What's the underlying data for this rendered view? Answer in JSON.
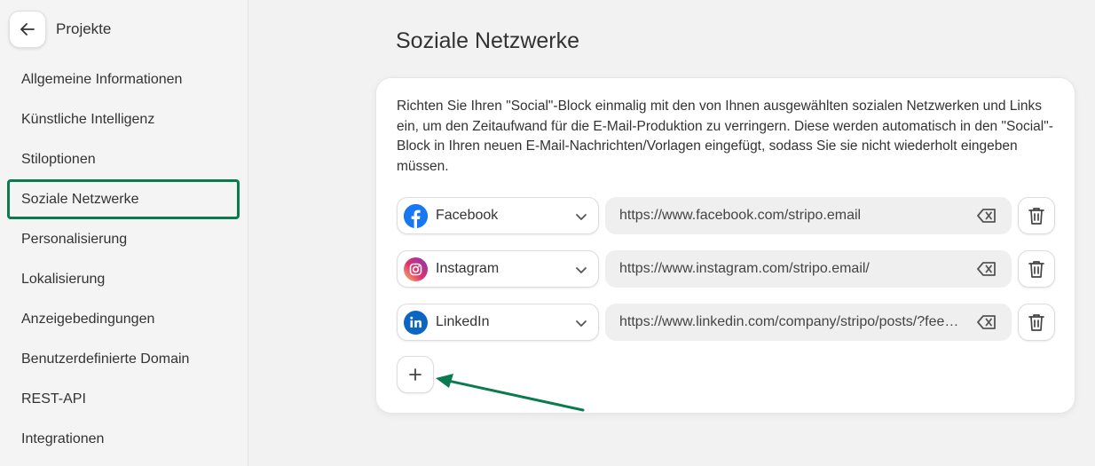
{
  "sidebar": {
    "back_title": "Projekte",
    "items": [
      {
        "label": "Allgemeine Informationen"
      },
      {
        "label": "Künstliche Intelligenz"
      },
      {
        "label": "Stiloptionen"
      },
      {
        "label": "Soziale Netzwerke",
        "active": true
      },
      {
        "label": "Personalisierung"
      },
      {
        "label": "Lokalisierung"
      },
      {
        "label": "Anzeigebedingungen"
      },
      {
        "label": "Benutzerdefinierte Domain"
      },
      {
        "label": "REST-API"
      },
      {
        "label": "Integrationen"
      }
    ]
  },
  "main": {
    "title": "Soziale Netzwerke",
    "description": "Richten Sie Ihren \"Social\"-Block einmalig mit den von Ihnen ausgewählten sozialen Netzwerken und Links ein, um den Zeitaufwand für die E-Mail-Produktion zu verringern. Diese werden automatisch in den \"Social\"-Block in Ihren neuen E-Mail-Nachrichten/Vorlagen eingefügt, sodass Sie sie nicht wiederholt eingeben müssen.",
    "networks": [
      {
        "name": "Facebook",
        "icon": "facebook-icon",
        "url": "https://www.facebook.com/stripo.email"
      },
      {
        "name": "Instagram",
        "icon": "instagram-icon",
        "url": "https://www.instagram.com/stripo.email/"
      },
      {
        "name": "LinkedIn",
        "icon": "linkedin-icon",
        "url": "https://www.linkedin.com/company/stripo/posts/?feedView=all"
      }
    ]
  },
  "colors": {
    "accent_green": "#0a7a4f",
    "facebook_blue": "#1877f2",
    "linkedin_blue": "#0a66c2"
  }
}
